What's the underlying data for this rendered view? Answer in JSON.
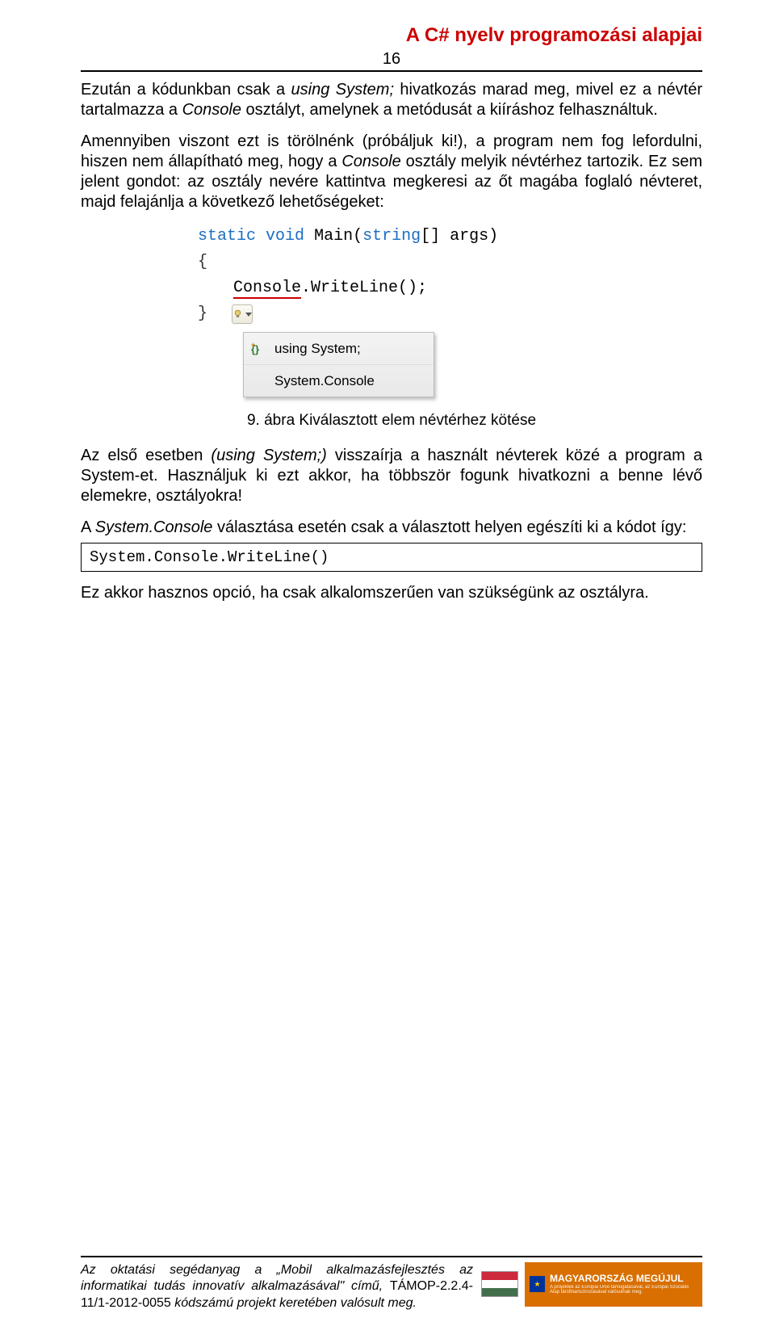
{
  "header": {
    "title": "A C# nyelv programozási alapjai",
    "page_number": "16"
  },
  "paragraph1": "Ezután a kódunkban csak a using System; hivatkozás marad meg, mivel ez a névtér tartalmazza a Console osztályt, amelynek a metódusát a kiíráshoz felhasználtuk.",
  "paragraph2": "Amennyiben viszont ezt is törölnénk (próbáljuk ki!), a program nem fog lefordulni, hiszen nem állapítható meg, hogy a Console osztály melyik névtérhez tartozik. Ez sem jelent gondot: az osztály nevére kattintva megkeresi az őt magába foglaló névteret, majd felajánlja a következő lehetőségeket:",
  "code_figure": {
    "line1_kw1": "static",
    "line1_kw2": "void",
    "line1_name": "Main(",
    "line1_kw3": "string",
    "line1_rest": "[] args)",
    "line2": "{",
    "line3_obj": "Console",
    "line3_call": ".WriteLine();",
    "line4": "}",
    "popup_item1": "using System;",
    "popup_item2": "System.Console"
  },
  "caption": "9. ábra Kiválasztott elem névtérhez kötése",
  "paragraph3_a": "Az első esetben ",
  "paragraph3_em": "(using System;)",
  "paragraph3_b": " visszaírja a használt névterek közé a program a System-et. Használjuk ki ezt akkor, ha többször fogunk hivatkozni a benne lévő elemekre, osztályokra!",
  "paragraph4_a": "A ",
  "paragraph4_em": "System.Console",
  "paragraph4_b": " választása esetén csak a választott helyen egészíti ki a kódot így:",
  "code_box": "System.Console.WriteLine()",
  "paragraph5": "Ez akkor hasznos opció, ha csak alkalomszerűen van szükségünk az osztályra.",
  "footer": {
    "text_a": "Az oktatási segédanyag a ",
    "text_em": "„Mobil alkalmazásfejlesztés az informatikai tudás innovatív alkalmazásával\"",
    "text_b": " című, ",
    "text_code": "TÁMOP-2.2.4-11/1-2012-0055",
    "text_c": " kódszámú projekt keretében valósult meg.",
    "banner_big": "MAGYARORSZÁG MEGÚJUL",
    "banner_small": "A projektek az Európai Unió támogatásával, az Európai Szociális Alap társfinanszírozásával valósulnak meg."
  }
}
